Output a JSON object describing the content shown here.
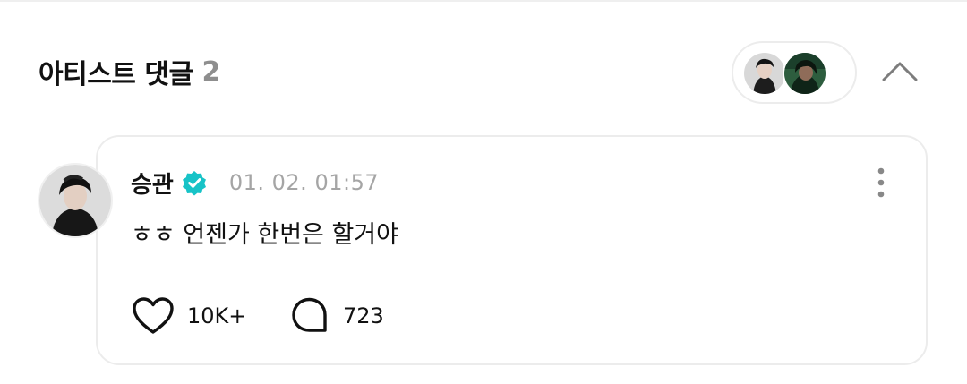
{
  "section": {
    "title": "아티스트 댓글",
    "count": "2"
  },
  "comment": {
    "author": "승관",
    "time": "01. 02. 01:57",
    "text": "ㅎㅎ 언젠가 한번은 할거야",
    "like_count": "10K+",
    "reply_count": "723"
  },
  "icons": {
    "collapse": "chevron-up-icon",
    "verified": "verified-badge-icon",
    "more": "more-vertical-icon",
    "like": "heart-icon",
    "reply": "speech-bubble-icon"
  },
  "colors": {
    "verified": "#17c3c7",
    "count": "#8e8e8e",
    "time": "#a5a5a5",
    "border": "#ececec"
  }
}
